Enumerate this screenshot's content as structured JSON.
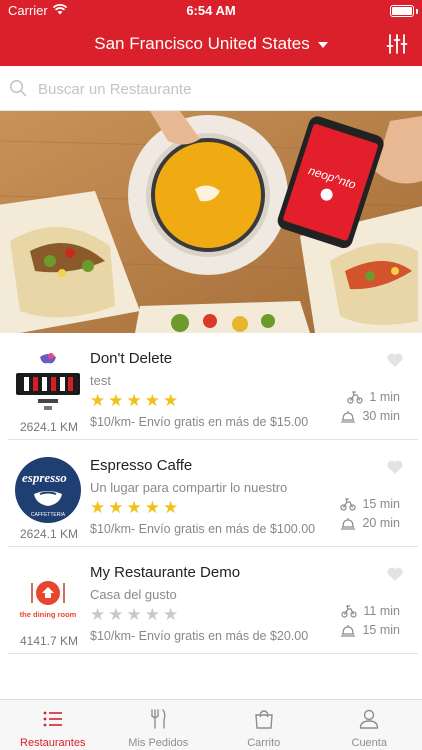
{
  "status_bar": {
    "carrier": "Carrier",
    "time": "6:54 AM"
  },
  "header": {
    "location": "San Francisco United States",
    "filter_icon": "sliders-icon"
  },
  "search": {
    "placeholder": "Buscar un Restaurante",
    "value": ""
  },
  "restaurants": [
    {
      "name": "Don't Delete",
      "description": "test",
      "rating": 5,
      "fee": "$10/km- Envío gratis en más de $15.00",
      "distance": "2624.1 KM",
      "delivery_time": "1 min",
      "pickup_time": "30 min"
    },
    {
      "name": "Espresso Caffe",
      "description": "Un lugar para compartir lo nuestro",
      "rating": 5,
      "fee": "$10/km- Envío gratis en más de $100.00",
      "distance": "2624.1 KM",
      "delivery_time": "15 min",
      "pickup_time": "20 min",
      "logo_text": "espresso",
      "logo_subtext": "CAFFETTERIA"
    },
    {
      "name": "My Restaurante Demo",
      "description": "Casa del gusto",
      "rating": 0,
      "fee": "$10/km- Envío gratis en más de $20.00",
      "distance": "4141.7 KM",
      "delivery_time": "11 min",
      "pickup_time": "15 min",
      "logo_text": "the dining room"
    }
  ],
  "tabs": [
    {
      "label": "Restaurantes",
      "icon": "list-icon",
      "active": true
    },
    {
      "label": "Mis Pedidos",
      "icon": "fork-knife-icon",
      "active": false
    },
    {
      "label": "Carrito",
      "icon": "shopping-bag-icon",
      "active": false
    },
    {
      "label": "Cuenta",
      "icon": "user-icon",
      "active": false
    }
  ],
  "colors": {
    "brand": "#d9202b",
    "star": "#f2c01a",
    "star_off": "#c9c9c9"
  },
  "hero": {
    "phone_logo_text": "neop^nto"
  }
}
